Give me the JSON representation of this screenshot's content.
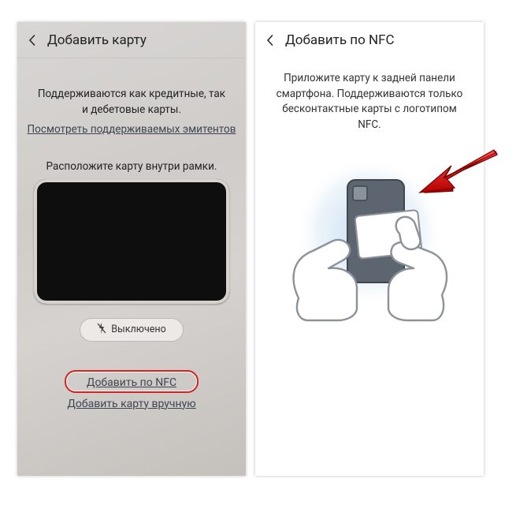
{
  "left": {
    "title": "Добавить карту",
    "support_text": "Поддерживаются как кредитные, так и дебетовые карты.",
    "issuers_link": "Посмотреть поддерживаемых эмитентов",
    "frame_caption": "Расположите карту внутри рамки.",
    "flash_label": "Выключено",
    "nfc_link": "Добавить по NFC",
    "manual_link": "Добавить карту вручную"
  },
  "right": {
    "title": "Добавить по NFC",
    "instruction": "Приложите карту к задней панели смартфона. Поддерживаются только бесконтактные карты с логотипом NFC."
  }
}
